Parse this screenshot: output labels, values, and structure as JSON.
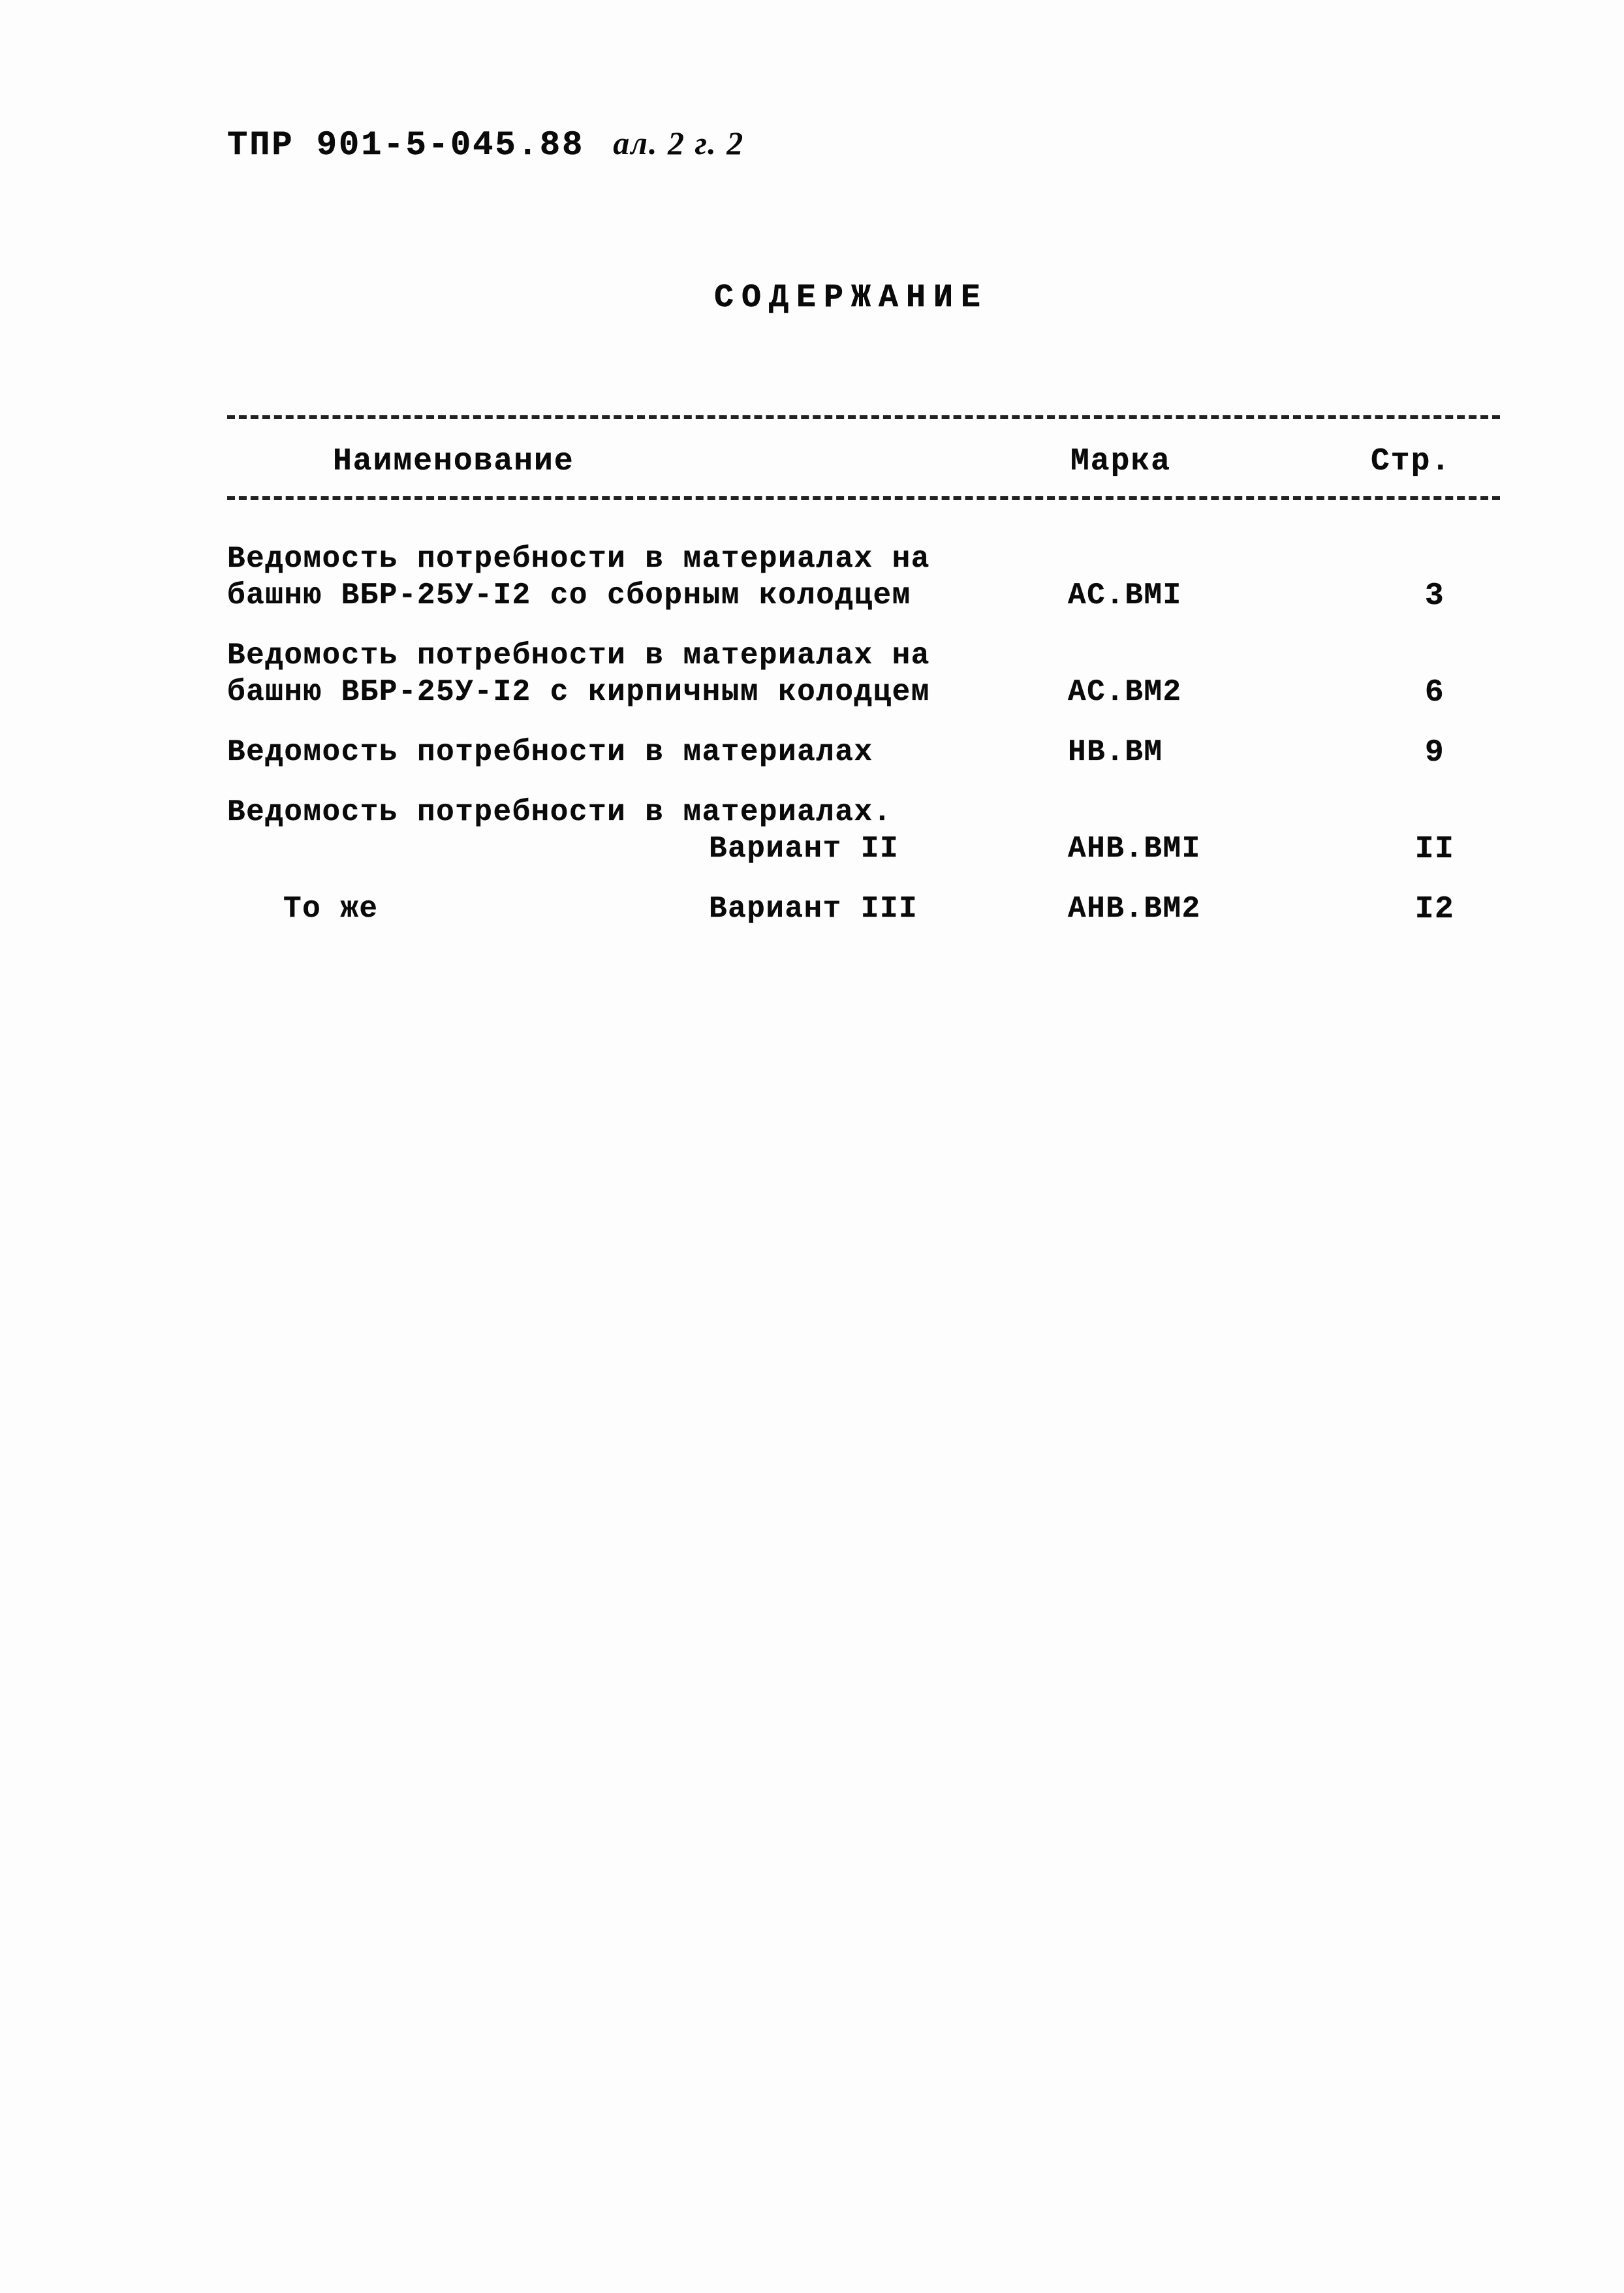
{
  "header": {
    "doc_code": "ТПР 901-5-045.88",
    "annotation": "ал. 2 г. 2"
  },
  "title": "СОДЕРЖАНИЕ",
  "table": {
    "columns": {
      "name": "Наименование",
      "mark": "Марка",
      "page": "Стр."
    },
    "rows": [
      {
        "name_line1": "Ведомость потребности в материалах на",
        "name_line2": "башню ВБР-25У-I2 со сборным колодцем",
        "variant": "",
        "mark": "АС.ВМI",
        "page": "3"
      },
      {
        "name_line1": "Ведомость потребности в материалах на",
        "name_line2": "башню ВБР-25У-I2 с кирпичным колодцем",
        "variant": "",
        "mark": "АС.ВМ2",
        "page": "6"
      },
      {
        "name_line1": "Ведомость потребности в материалах",
        "name_line2": "",
        "variant": "",
        "mark": "НВ.ВМ",
        "page": "9"
      },
      {
        "name_line1": "Ведомость потребности в материалах.",
        "name_line2": "",
        "variant": "Вариант II",
        "mark": "АНВ.ВМI",
        "page": "II"
      },
      {
        "name_line1": "То же",
        "name_line2": "",
        "variant": "Вариант III",
        "mark": "АНВ.ВМ2",
        "page": "I2"
      }
    ]
  }
}
